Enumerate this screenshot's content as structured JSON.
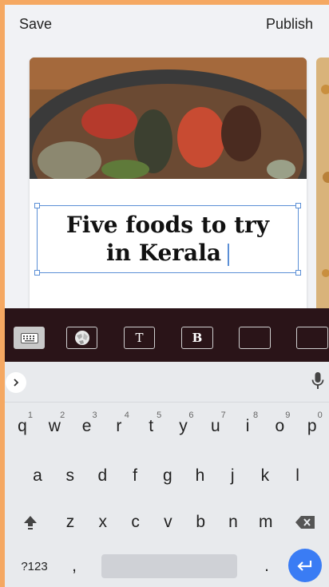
{
  "topbar": {
    "save": "Save",
    "publish": "Publish"
  },
  "card": {
    "title_line1": "Five foods to try",
    "title_line2": "in Kerala"
  },
  "format_bar": {
    "text_label": "T",
    "bold_label": "B"
  },
  "keyboard": {
    "row1": [
      {
        "k": "q",
        "n": "1"
      },
      {
        "k": "w",
        "n": "2"
      },
      {
        "k": "e",
        "n": "3"
      },
      {
        "k": "r",
        "n": "4"
      },
      {
        "k": "t",
        "n": "5"
      },
      {
        "k": "y",
        "n": "6"
      },
      {
        "k": "u",
        "n": "7"
      },
      {
        "k": "i",
        "n": "8"
      },
      {
        "k": "o",
        "n": "9"
      },
      {
        "k": "p",
        "n": "0"
      }
    ],
    "row2": [
      "a",
      "s",
      "d",
      "f",
      "g",
      "h",
      "j",
      "k",
      "l"
    ],
    "row3": [
      "z",
      "x",
      "c",
      "v",
      "b",
      "n",
      "m"
    ],
    "symbols": "?123",
    "comma": ",",
    "period": "."
  },
  "colors": {
    "accent": "#5b8fd6",
    "enter": "#3a7cf4",
    "toolbar": "#2a1418",
    "frame": "#f5a862"
  }
}
